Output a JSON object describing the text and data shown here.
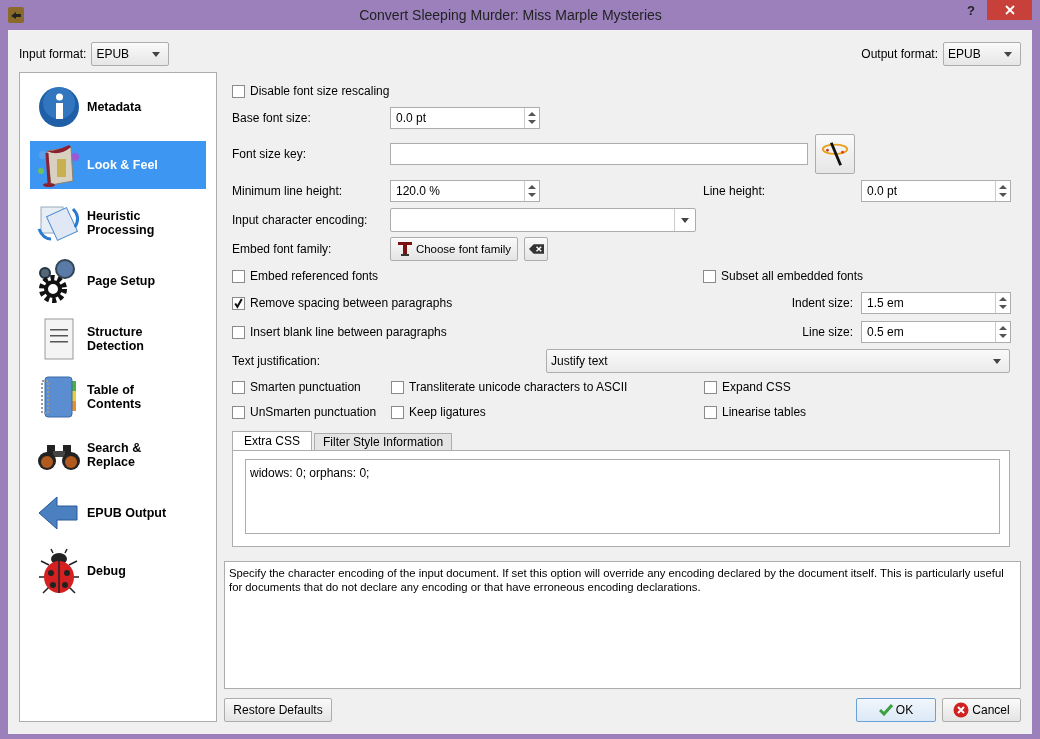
{
  "window": {
    "title": "Convert Sleeping Murder: Miss Marple Mysteries",
    "help": "?"
  },
  "input_format": {
    "label": "Input format:",
    "value": "EPUB"
  },
  "output_format": {
    "label": "Output format:",
    "value": "EPUB"
  },
  "sidebar": {
    "items": [
      {
        "label": "Metadata",
        "selected": false
      },
      {
        "label": "Look & Feel",
        "selected": true
      },
      {
        "label": "Heuristic Processing",
        "selected": false
      },
      {
        "label": "Page Setup",
        "selected": false
      },
      {
        "label": "Structure Detection",
        "selected": false
      },
      {
        "label": "Table of Contents",
        "selected": false
      },
      {
        "label": "Search & Replace",
        "selected": false
      },
      {
        "label": "EPUB Output",
        "selected": false
      },
      {
        "label": "Debug",
        "selected": false
      }
    ]
  },
  "look_and_feel": {
    "disable_font_size_rescaling": {
      "label": "Disable font size rescaling",
      "checked": false
    },
    "base_font_size": {
      "label": "Base font size:",
      "value": "0.0 pt"
    },
    "font_size_key": {
      "label": "Font size key:"
    },
    "minimum_line_height": {
      "label": "Minimum line height:",
      "value": "120.0 %"
    },
    "line_height": {
      "label": "Line height:",
      "value": "0.0 pt"
    },
    "input_character_encoding": {
      "label": "Input character encoding:"
    },
    "embed_font_family": {
      "label": "Embed font family:",
      "button": "Choose font family"
    },
    "embed_referenced_fonts": {
      "label": "Embed referenced fonts",
      "checked": false
    },
    "subset_all_embedded_fonts": {
      "label": "Subset all embedded fonts",
      "checked": false
    },
    "remove_spacing_between_paragraphs": {
      "label": "Remove spacing between paragraphs",
      "checked": true
    },
    "indent_size": {
      "label": "Indent size:",
      "value": "1.5 em"
    },
    "insert_blank_line": {
      "label": "Insert blank line between paragraphs",
      "checked": false
    },
    "line_size": {
      "label": "Line size:",
      "value": "0.5 em"
    },
    "text_justification": {
      "label": "Text justification:",
      "value": "Justify text"
    },
    "options": [
      {
        "label": "Smarten punctuation",
        "checked": false
      },
      {
        "label": "Transliterate unicode characters to ASCII",
        "checked": false
      },
      {
        "label": "Expand CSS",
        "checked": false
      },
      {
        "label": "UnSmarten punctuation",
        "checked": false
      },
      {
        "label": "Keep ligatures",
        "checked": false
      },
      {
        "label": "Linearise tables",
        "checked": false
      }
    ],
    "tabs": [
      {
        "label": "Extra CSS",
        "selected": true
      },
      {
        "label": "Filter Style Information",
        "selected": false
      }
    ],
    "extra_css": "widows: 0; orphans: 0;"
  },
  "help_text": "Specify the character encoding of the input document. If set this option will override any encoding declared by the document itself. This is particularly useful for documents that do not declare any encoding or that have erroneous encoding declarations.",
  "buttons": {
    "restore": "Restore Defaults",
    "ok": "OK",
    "cancel": "Cancel"
  }
}
